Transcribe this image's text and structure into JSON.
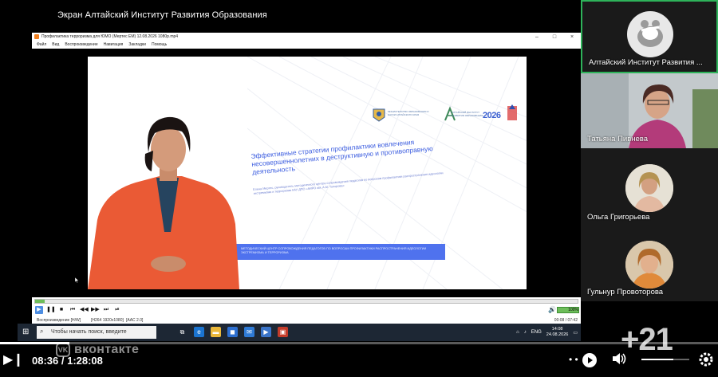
{
  "screen_share": {
    "title": "Экран Алтайский Институт Развития Образования",
    "window": {
      "title": "Профилактика терроризма для ЮМО (Мертес ЕМ) 12.08.2026 1080p.mp4",
      "menu": [
        "Файл",
        "Вид",
        "Воспроизведение",
        "Навигация",
        "Закладки",
        "Помощь"
      ],
      "controls": [
        "–",
        "□",
        "×"
      ]
    },
    "slide": {
      "heading": "Эффективные стратегии профилактики вовлечения несовершеннолетних в деструктивную и противоправную деятельность",
      "author": "Елена Мертес, руководитель методического центра сопровождения педагогов по вопросам профилактики распространения идеологии экстремизма и терроризма КАУ ДПО «АИРО им. А.М. Топорова»",
      "banner": "МЕТОДИЧЕСКИЙ ЦЕНТР СОПРОВОЖДЕНИЯ ПЕДАГОГОВ ПО ВОПРОСАМ ПРОФИЛАКТИКИ РАСПРОСТРАНЕНИЯ ИДЕОЛОГИИ ЭКСТРЕМИЗМА И ТЕРРОРИЗМА",
      "logo_ministry": "МИНИСТЕРСТВО ОБРАЗОВАНИЯ И НАУКИ АЛТАЙСКОГО КРАЯ",
      "logo_airo": "АЛТАЙСКИЙ ИНСТИТУТ РАЗВИТИЯ ОБРАЗОВАНИЯ",
      "logo_year": "2026"
    },
    "player": {
      "progress_fraction": 0.018,
      "volume": "100%",
      "status_left": "Воспроизведение [H/W]",
      "codec": "[H264 1920x1080]",
      "audio": "[AAC 2.0]",
      "time": "00:08 / 07:42",
      "buttons": [
        "▶",
        "❚❚",
        "■",
        "⏮",
        "◀◀",
        "▶▶",
        "⏭",
        "⏯"
      ]
    },
    "taskbar": {
      "search_placeholder": "Чтобы начать поиск, введите",
      "lang": "ENG",
      "clock_time": "14:08",
      "clock_date": "24.08.2026",
      "apps": [
        {
          "icon": "task-view-icon",
          "color": "#1d2734",
          "glyph": "⧉"
        },
        {
          "icon": "edge-icon",
          "color": "#1b74d0",
          "glyph": "e"
        },
        {
          "icon": "folder-icon",
          "color": "#e9b73a",
          "glyph": "▬"
        },
        {
          "icon": "store-icon",
          "color": "#2d6fd0",
          "glyph": "◼"
        },
        {
          "icon": "mail-icon",
          "color": "#2f7bd6",
          "glyph": "✉"
        },
        {
          "icon": "media-player-icon",
          "color": "#3a74c9",
          "glyph": "▶"
        },
        {
          "icon": "presentation-icon",
          "color": "#c43c2a",
          "glyph": "▣"
        }
      ]
    }
  },
  "participants": [
    {
      "name": "Алтайский Институт Развития ...",
      "kind": "logo"
    },
    {
      "name": "Татьяна Пивнева",
      "kind": "video"
    },
    {
      "name": "Ольга Григорьева",
      "kind": "avatar"
    },
    {
      "name": "Гульнур Провоторова",
      "kind": "avatar"
    }
  ],
  "overlay": {
    "brand": "вконтакте",
    "brand_badge": "VK",
    "time": "08:36 / 1:28:08",
    "progress_fraction": 0.097,
    "extra_participants": "+21",
    "colors": {
      "accent_green": "#2eb35a",
      "banner_blue": "#4f72ee"
    }
  }
}
